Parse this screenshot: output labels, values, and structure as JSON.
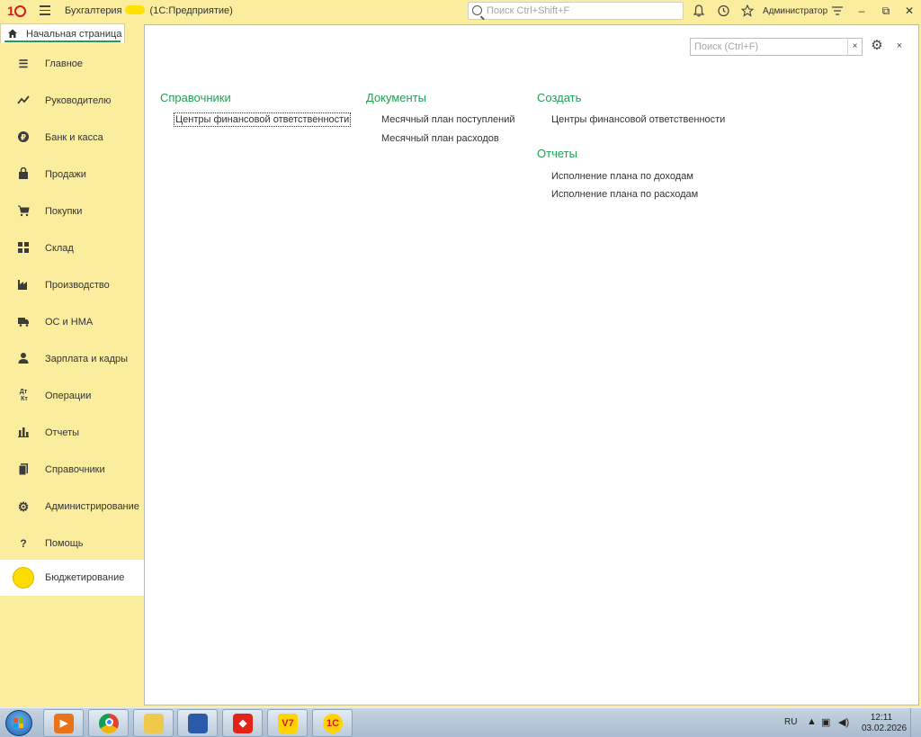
{
  "titlebar": {
    "app_name": "Бухгалтерия",
    "platform": "(1С:Предприятие)",
    "search_placeholder": "Поиск Ctrl+Shift+F",
    "user": "Администратор"
  },
  "tabs": {
    "home": "Начальная страница"
  },
  "sidebar": {
    "items": [
      {
        "label": "Главное",
        "icon": "list-icon"
      },
      {
        "label": "Руководителю",
        "icon": "trend-icon"
      },
      {
        "label": "Банк и касса",
        "icon": "ruble-icon"
      },
      {
        "label": "Продажи",
        "icon": "bag-icon"
      },
      {
        "label": "Покупки",
        "icon": "cart-icon"
      },
      {
        "label": "Склад",
        "icon": "grid-icon"
      },
      {
        "label": "Производство",
        "icon": "factory-icon"
      },
      {
        "label": "ОС и НМА",
        "icon": "truck-icon"
      },
      {
        "label": "Зарплата и кадры",
        "icon": "person-icon"
      },
      {
        "label": "Операции",
        "icon": "debit-credit-icon"
      },
      {
        "label": "Отчеты",
        "icon": "bar-chart-icon"
      },
      {
        "label": "Справочники",
        "icon": "book-icon"
      },
      {
        "label": "Администрирование",
        "icon": "gear-icon"
      },
      {
        "label": "Помощь",
        "icon": "question-icon"
      },
      {
        "label": "Бюджетирование",
        "icon": "yellow-circle-icon",
        "active": true
      }
    ]
  },
  "main": {
    "search_placeholder": "Поиск (Ctrl+F)",
    "clear_label": "×",
    "close_label": "×",
    "sections": {
      "catalogs": {
        "title": "Справочники",
        "links": [
          "Центры финансовой ответственности"
        ]
      },
      "documents": {
        "title": "Документы",
        "links": [
          "Месячный план поступлений",
          "Месячный план расходов"
        ]
      },
      "create": {
        "title": "Создать",
        "links": [
          "Центры финансовой ответственности"
        ]
      },
      "reports": {
        "title": "Отчеты",
        "links": [
          "Исполнение плана по доходам",
          "Исполнение плана по расходам"
        ]
      }
    }
  },
  "taskbar": {
    "lang": "RU",
    "time": "12:11",
    "date": "03.02.2026"
  },
  "colors": {
    "accent_green": "#1fa055",
    "sidebar_bg": "#fbed9e",
    "brand_red": "#d71920"
  }
}
